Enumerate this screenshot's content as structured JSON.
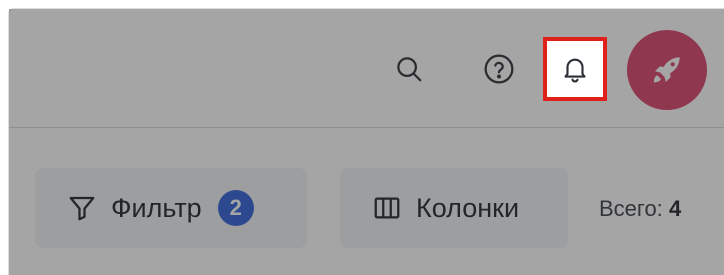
{
  "topbar": {
    "icons": {
      "search": "search-icon",
      "help": "help-circle-icon",
      "notifications": "bell-icon",
      "avatar": "rocket-icon"
    },
    "avatar_color": "#d9426a",
    "highlight_color": "#e0201b"
  },
  "toolbar": {
    "filter_label": "Фильтр",
    "filter_count": "2",
    "columns_label": "Колонки",
    "total_label": "Всего:",
    "total_value": "4"
  },
  "colors": {
    "badge": "#2f5fd7",
    "button_bg": "#f1f3f6"
  }
}
